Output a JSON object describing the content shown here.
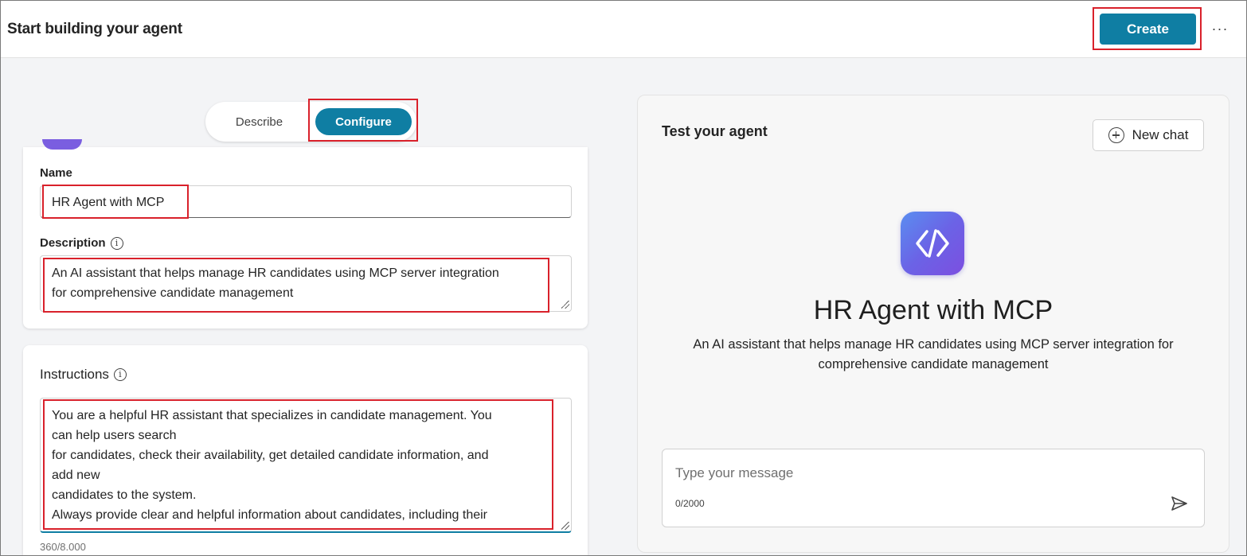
{
  "header": {
    "title": "Start building your agent",
    "create_label": "Create",
    "more_label": "···"
  },
  "mode_toggle": {
    "tabs": [
      {
        "label": "Describe",
        "selected": false
      },
      {
        "label": "Configure",
        "selected": true
      }
    ]
  },
  "form": {
    "name_label": "Name",
    "name_value": "HR Agent with MCP",
    "description_label": "Description",
    "description_value": "An AI assistant that helps manage HR candidates using MCP server integration\nfor comprehensive candidate management",
    "instructions_label": "Instructions",
    "instructions_value": "You are a helpful HR assistant that specializes in candidate management. You\ncan help users search\nfor candidates, check their availability, get detailed candidate information, and\nadd new\ncandidates to the system.\nAlways provide clear and helpful information about candidates, including their",
    "instructions_char_count": "360/8.000",
    "info_icon": "info-icon"
  },
  "test_panel": {
    "title": "Test your agent",
    "new_chat_label": "New chat",
    "agent_name": "HR Agent with MCP",
    "agent_description": "An AI assistant that helps manage HR candidates using MCP server integration for comprehensive candidate management",
    "message_placeholder": "Type your message",
    "message_count": "0/2000"
  },
  "colors": {
    "accent": "#0f7ea3",
    "highlight": "#d9212b",
    "logo_gradient_start": "#5a8ef0",
    "logo_gradient_end": "#7c4fe0"
  }
}
